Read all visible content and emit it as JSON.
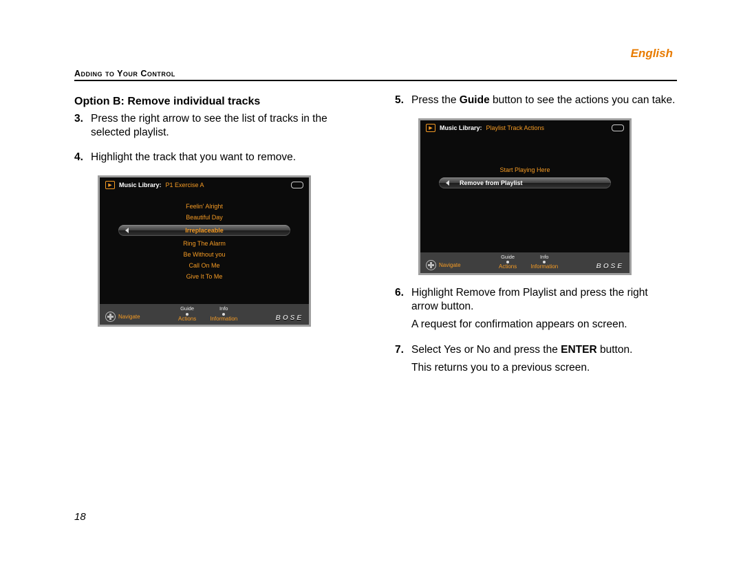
{
  "language_label": "English",
  "section_header": "Adding to Your Control",
  "page_number": "18",
  "left": {
    "option_heading": "Option B: Remove individual tracks",
    "steps": [
      {
        "num": "3.",
        "text": "Press the right arrow to see the list of tracks in the selected playlist."
      },
      {
        "num": "4.",
        "text": "Highlight the track that you want to remove."
      }
    ]
  },
  "right": {
    "steps_a": [
      {
        "num": "5.",
        "html": "Press the <b>Guide</b> button to see the actions you can take."
      }
    ],
    "steps_b": [
      {
        "num": "6.",
        "html": "Highlight Remove from Playlist and press the right arrow button.",
        "extra": "A request for confirmation appears on screen."
      },
      {
        "num": "7.",
        "html": "Select Yes or No and press the <b>ENTER</b> button.",
        "extra": "This returns you to a previous screen."
      }
    ]
  },
  "screenA": {
    "title_prefix": "Music Library:",
    "title_crumb": "P1 Exercise A",
    "tracks": [
      {
        "label": "Feelin' Alright",
        "selected": false
      },
      {
        "label": "Beautiful Day",
        "selected": false
      },
      {
        "label": "Irreplaceable",
        "selected": true
      },
      {
        "label": "Ring The Alarm",
        "selected": false
      },
      {
        "label": "Be Without you",
        "selected": false
      },
      {
        "label": "Call On Me",
        "selected": false
      },
      {
        "label": "Give It To Me",
        "selected": false
      }
    ],
    "footer": {
      "navigate": "Navigate",
      "guide_top": "Guide",
      "guide_bottom": "Actions",
      "info_top": "Info",
      "info_bottom": "Information",
      "logo": "BOSE"
    }
  },
  "screenB": {
    "title_prefix": "Music Library:",
    "title_crumb": "Playlist Track Actions",
    "actions": [
      {
        "label": "Start Playing Here",
        "selected": false
      },
      {
        "label": "Remove from Playlist",
        "selected": true
      }
    ],
    "footer": {
      "navigate": "Navigate",
      "guide_top": "Guide",
      "guide_bottom": "Actions",
      "info_top": "Info",
      "info_bottom": "Information",
      "logo": "BOSE"
    }
  }
}
